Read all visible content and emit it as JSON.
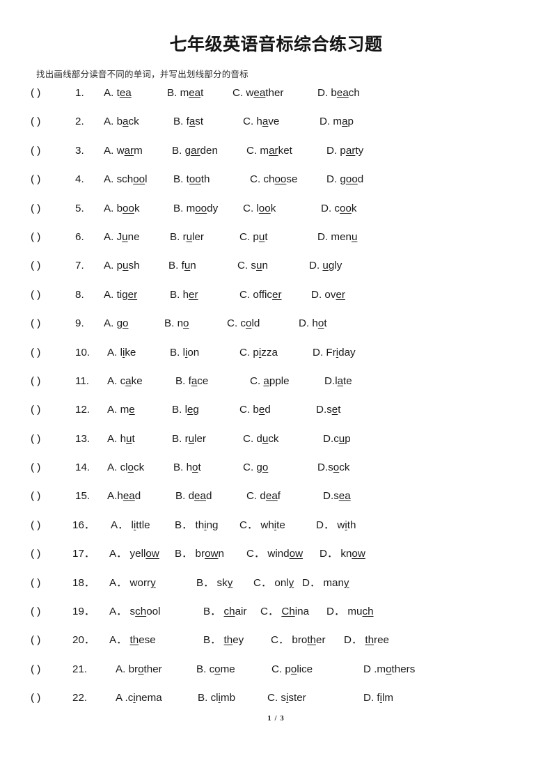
{
  "document": {
    "title": "七年级英语音标综合练习题",
    "subtitle": "找出画线部分读音不同的单词，并写出划线部分的音标",
    "footer_page": "1 / 3"
  },
  "bracket": "(      )",
  "questions": [
    {
      "number": "1.",
      "num_x": 64,
      "cols": [
        105,
        196,
        290,
        412
      ],
      "options": [
        {
          "label": "A.",
          "pre": "t",
          "mid": "ea",
          "post": ""
        },
        {
          "label": "B.",
          "pre": "m",
          "mid": "ea",
          "post": "t"
        },
        {
          "label": "C.",
          "pre": "w",
          "mid": "ea",
          "post": "ther"
        },
        {
          "label": "D.",
          "pre": "b",
          "mid": "ea",
          "post": "ch"
        }
      ]
    },
    {
      "number": "2.",
      "num_x": 64,
      "cols": [
        105,
        205,
        305,
        415
      ],
      "options": [
        {
          "label": "A.",
          "pre": "b",
          "mid": "a",
          "post": "ck"
        },
        {
          "label": "B.",
          "pre": "f",
          "mid": "a",
          "post": "st"
        },
        {
          "label": "C.",
          "pre": "h",
          "mid": "a",
          "post": "ve"
        },
        {
          "label": "D.",
          "pre": "m",
          "mid": "a",
          "post": "p"
        }
      ]
    },
    {
      "number": "3.",
      "num_x": 64,
      "cols": [
        105,
        203,
        310,
        425
      ],
      "options": [
        {
          "label": "A.",
          "pre": "w",
          "mid": "ar",
          "post": "m"
        },
        {
          "label": "B.",
          "pre": "g",
          "mid": "ar",
          "post": "den"
        },
        {
          "label": "C.",
          "pre": "m",
          "mid": "ar",
          "post": "ket"
        },
        {
          "label": "D.",
          "pre": "p",
          "mid": "ar",
          "post": "ty"
        }
      ]
    },
    {
      "number": "4.",
      "num_x": 64,
      "cols": [
        105,
        205,
        315,
        425
      ],
      "options": [
        {
          "label": "A.",
          "pre": "sch",
          "mid": "oo",
          "post": "l"
        },
        {
          "label": "B.",
          "pre": "t",
          "mid": "oo",
          "post": "th"
        },
        {
          "label": "C.",
          "pre": "ch",
          "mid": "oo",
          "post": "se"
        },
        {
          "label": "D.",
          "pre": "g",
          "mid": "oo",
          "post": "d"
        }
      ]
    },
    {
      "number": "5.",
      "num_x": 64,
      "cols": [
        105,
        205,
        305,
        417
      ],
      "options": [
        {
          "label": "A.",
          "pre": "b",
          "mid": "oo",
          "post": "k"
        },
        {
          "label": "B.",
          "pre": "m",
          "mid": "oo",
          "post": "dy"
        },
        {
          "label": "C.",
          "pre": "l",
          "mid": "oo",
          "post": "k"
        },
        {
          "label": "D.",
          "pre": "c",
          "mid": "oo",
          "post": "k"
        }
      ]
    },
    {
      "number": "6.",
      "num_x": 64,
      "cols": [
        105,
        200,
        300,
        412
      ],
      "options": [
        {
          "label": "A.",
          "pre": "J",
          "mid": "u",
          "post": "ne"
        },
        {
          "label": "B.",
          "pre": "r",
          "mid": "u",
          "post": "ler"
        },
        {
          "label": "C.",
          "pre": "p",
          "mid": "u",
          "post": "t"
        },
        {
          "label": "D.",
          "pre": "men",
          "mid": "u",
          "post": ""
        }
      ]
    },
    {
      "number": "7.",
      "num_x": 64,
      "cols": [
        105,
        198,
        297,
        400
      ],
      "options": [
        {
          "label": "A.",
          "pre": "p",
          "mid": "u",
          "post": "sh"
        },
        {
          "label": "B.",
          "pre": "f",
          "mid": "u",
          "post": "n"
        },
        {
          "label": "C.",
          "pre": "s",
          "mid": "u",
          "post": "n"
        },
        {
          "label": "D.",
          "pre": "",
          "mid": "u",
          "post": "gly"
        }
      ]
    },
    {
      "number": "8.",
      "num_x": 64,
      "cols": [
        105,
        200,
        300,
        403
      ],
      "options": [
        {
          "label": "A.",
          "pre": "tig",
          "mid": "er",
          "post": ""
        },
        {
          "label": "B.",
          "pre": "h",
          "mid": "er",
          "post": ""
        },
        {
          "label": "C.",
          "pre": "offic",
          "mid": "er",
          "post": ""
        },
        {
          "label": "D.",
          "pre": "ov",
          "mid": "er",
          "post": ""
        }
      ]
    },
    {
      "number": "9.",
      "num_x": 64,
      "cols": [
        105,
        192,
        282,
        385
      ],
      "options": [
        {
          "label": "A.",
          "pre": "g",
          "mid": "o",
          "post": ""
        },
        {
          "label": "B.",
          "pre": "n",
          "mid": "o",
          "post": ""
        },
        {
          "label": "C.",
          "pre": "c",
          "mid": "o",
          "post": "ld"
        },
        {
          "label": "D.",
          "pre": "h",
          "mid": "o",
          "post": "t"
        }
      ]
    },
    {
      "number": "10.",
      "num_x": 64,
      "cols": [
        110,
        200,
        300,
        405
      ],
      "options": [
        {
          "label": "A.",
          "pre": "l",
          "mid": "i",
          "post": "ke"
        },
        {
          "label": "B.",
          "pre": "l",
          "mid": "i",
          "post": "on"
        },
        {
          "label": "C.",
          "pre": "p",
          "mid": "i",
          "post": "zza"
        },
        {
          "label": "D.",
          "pre": "Fr",
          "mid": "i",
          "post": "day"
        }
      ]
    },
    {
      "number": "11.",
      "num_x": 64,
      "cols": [
        110,
        208,
        315,
        422
      ],
      "options": [
        {
          "label": "A.",
          "pre": "c",
          "mid": "a",
          "post": "ke"
        },
        {
          "label": "B.",
          "pre": "f",
          "mid": "a",
          "post": "ce"
        },
        {
          "label": "C.",
          "pre": "",
          "mid": "a",
          "post": "pple"
        },
        {
          "label": "D.",
          "pre": "l",
          "mid": "a",
          "post": "te",
          "tight": true
        }
      ]
    },
    {
      "number": "12.",
      "num_x": 64,
      "cols": [
        110,
        203,
        300,
        410
      ],
      "options": [
        {
          "label": "A.",
          "pre": "m",
          "mid": "e",
          "post": ""
        },
        {
          "label": "B.",
          "pre": "l",
          "mid": "e",
          "post": "g"
        },
        {
          "label": "C.",
          "pre": "b",
          "mid": "e",
          "post": "d"
        },
        {
          "label": "D.",
          "pre": "s",
          "mid": "e",
          "post": "t",
          "tight": true
        }
      ]
    },
    {
      "number": "13.",
      "num_x": 64,
      "cols": [
        110,
        203,
        305,
        420
      ],
      "options": [
        {
          "label": "A.",
          "pre": "h",
          "mid": "u",
          "post": "t"
        },
        {
          "label": "B.",
          "pre": "r",
          "mid": "u",
          "post": "ler"
        },
        {
          "label": "C.",
          "pre": "d",
          "mid": "u",
          "post": "ck"
        },
        {
          "label": "D.",
          "pre": "c",
          "mid": "u",
          "post": "p",
          "tight": true
        }
      ]
    },
    {
      "number": "14.",
      "num_x": 64,
      "cols": [
        110,
        205,
        305,
        412
      ],
      "options": [
        {
          "label": "A.",
          "pre": "cl",
          "mid": "o",
          "post": "ck"
        },
        {
          "label": "B.",
          "pre": "h",
          "mid": "o",
          "post": "t"
        },
        {
          "label": "C.",
          "pre": "g",
          "mid": "o",
          "post": ""
        },
        {
          "label": "D.",
          "pre": "s",
          "mid": "o",
          "post": "ck",
          "tight": true
        }
      ]
    },
    {
      "number": "15.",
      "num_x": 64,
      "cols": [
        110,
        208,
        310,
        420
      ],
      "options": [
        {
          "label": "A.",
          "pre": "h",
          "mid": "ea",
          "post": "d",
          "tight": true
        },
        {
          "label": "B.",
          "pre": "d",
          "mid": "ea",
          "post": "d"
        },
        {
          "label": "C.",
          "pre": "d",
          "mid": "ea",
          "post": "f"
        },
        {
          "label": "D.",
          "pre": "s",
          "mid": "ea",
          "post": "",
          "tight": true
        }
      ]
    },
    {
      "number": "16．",
      "num_x": 60,
      "cols": [
        115,
        207,
        300,
        410
      ],
      "options": [
        {
          "label": "A．",
          "pre": "l",
          "mid": "i",
          "post": "ttle"
        },
        {
          "label": "B．",
          "pre": "th",
          "mid": "i",
          "post": "ng"
        },
        {
          "label": "C．",
          "pre": "wh",
          "mid": "i",
          "post": "te"
        },
        {
          "label": "D．",
          "pre": "w",
          "mid": "i",
          "post": "th"
        }
      ]
    },
    {
      "number": "17．",
      "num_x": 60,
      "cols": [
        113,
        207,
        310,
        415
      ],
      "options": [
        {
          "label": "A．",
          "pre": "yell",
          "mid": "ow",
          "post": ""
        },
        {
          "label": "B．",
          "pre": "br",
          "mid": "ow",
          "post": "n"
        },
        {
          "label": "C．",
          "pre": "wind",
          "mid": "ow",
          "post": ""
        },
        {
          "label": "D．",
          "pre": "kn",
          "mid": "ow",
          "post": ""
        }
      ]
    },
    {
      "number": "18．",
      "num_x": 60,
      "cols": [
        113,
        238,
        320,
        390
      ],
      "options": [
        {
          "label": "A．",
          "pre": "worr",
          "mid": "y",
          "post": ""
        },
        {
          "label": "B．",
          "pre": "sk",
          "mid": "y",
          "post": ""
        },
        {
          "label": "C．",
          "pre": "onl",
          "mid": "y",
          "post": ""
        },
        {
          "label": "D．",
          "pre": "man",
          "mid": "y",
          "post": ""
        }
      ]
    },
    {
      "number": "19．",
      "num_x": 60,
      "cols": [
        113,
        248,
        330,
        425
      ],
      "options": [
        {
          "label": "A．",
          "pre": "s",
          "mid": "ch",
          "post": "ool"
        },
        {
          "label": "B．",
          "pre": "",
          "mid": "ch",
          "post": "air"
        },
        {
          "label": "C．",
          "pre": "",
          "mid": "Ch",
          "post": "ina"
        },
        {
          "label": "D．",
          "pre": "mu",
          "mid": "ch",
          "post": ""
        }
      ]
    },
    {
      "number": "20．",
      "num_x": 60,
      "cols": [
        113,
        248,
        345,
        450
      ],
      "options": [
        {
          "label": "A．",
          "pre": "",
          "mid": "th",
          "post": "ese"
        },
        {
          "label": "B．",
          "pre": "",
          "mid": "th",
          "post": "ey"
        },
        {
          "label": "C．",
          "pre": "bro",
          "mid": "th",
          "post": "er"
        },
        {
          "label": "D．",
          "pre": "",
          "mid": "th",
          "post": "ree"
        }
      ]
    },
    {
      "number": "21.",
      "num_x": 60,
      "cols": [
        122,
        238,
        346,
        478
      ],
      "options": [
        {
          "label": "A.",
          "pre": "br",
          "mid": "o",
          "post": "ther"
        },
        {
          "label": "B.",
          "pre": "c",
          "mid": "o",
          "post": "me"
        },
        {
          "label": "C.",
          "pre": "p",
          "mid": "o",
          "post": "lice"
        },
        {
          "label": "D .",
          "pre": "m",
          "mid": "o",
          "post": "thers",
          "tight": true
        }
      ]
    },
    {
      "number": "22.",
      "num_x": 60,
      "cols": [
        122,
        240,
        340,
        478
      ],
      "options": [
        {
          "label": "A .",
          "pre": "c",
          "mid": "i",
          "post": "nema",
          "tight": true
        },
        {
          "label": "B.",
          "pre": "cl",
          "mid": "i",
          "post": "mb"
        },
        {
          "label": "C.",
          "pre": "s",
          "mid": "i",
          "post": "ster"
        },
        {
          "label": "D.",
          "pre": "f",
          "mid": "i",
          "post": "lm"
        }
      ]
    }
  ]
}
